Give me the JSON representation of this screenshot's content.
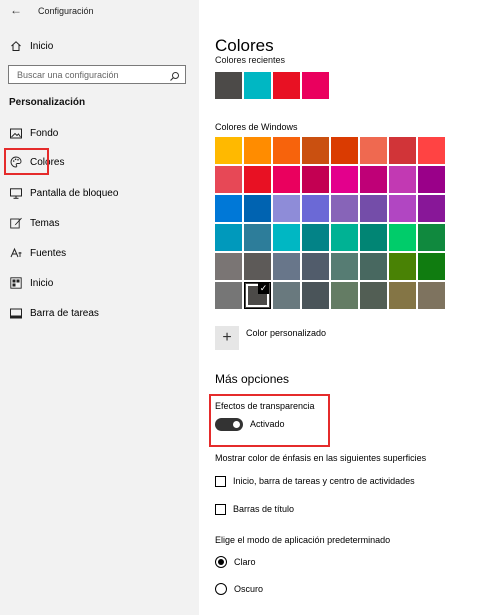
{
  "window": {
    "title": "Configuración"
  },
  "sidebar": {
    "home_label": "Inicio",
    "search_placeholder": "Buscar una configuración",
    "section_title": "Personalización",
    "items": [
      {
        "label": "Fondo",
        "icon": "image-icon"
      },
      {
        "label": "Colores",
        "icon": "palette-icon",
        "selected": true
      },
      {
        "label": "Pantalla de bloqueo",
        "icon": "monitor-icon"
      },
      {
        "label": "Temas",
        "icon": "brush-icon"
      },
      {
        "label": "Fuentes",
        "icon": "font-icon"
      },
      {
        "label": "Inicio",
        "icon": "start-icon"
      },
      {
        "label": "Barra de tareas",
        "icon": "taskbar-icon"
      }
    ]
  },
  "main": {
    "title": "Colores",
    "recent_label": "Colores recientes",
    "recent_colors": [
      "#4c4a48",
      "#00b7c3",
      "#e81123",
      "#ea005e"
    ],
    "windows_label": "Colores de Windows",
    "windows_colors": [
      [
        "#ffb900",
        "#ff8c00",
        "#f7630c",
        "#ca5010",
        "#da3b01",
        "#ef6950",
        "#d13438",
        "#ff4343"
      ],
      [
        "#e74856",
        "#e81123",
        "#ea005e",
        "#c30052",
        "#e3008c",
        "#bf0077",
        "#c239b3",
        "#9a0089"
      ],
      [
        "#0078d7",
        "#0063b1",
        "#8e8cd8",
        "#6b69d6",
        "#8764b8",
        "#744da9",
        "#b146c2",
        "#881798"
      ],
      [
        "#0099bc",
        "#2d7d9a",
        "#00b7c3",
        "#038387",
        "#00b294",
        "#018574",
        "#00cc6a",
        "#10893e"
      ],
      [
        "#7a7574",
        "#5d5a58",
        "#68768a",
        "#515c6b",
        "#567c73",
        "#486860",
        "#498205",
        "#107c10"
      ],
      [
        "#767676",
        "#4c4a48",
        "#69797e",
        "#4a5459",
        "#647c64",
        "#525e54",
        "#847545",
        "#7e735f"
      ]
    ],
    "selected_color": "#4c4a48",
    "custom_color_label": "Color personalizado",
    "more_options_title": "Más opciones",
    "transparency_label": "Efectos de transparencia",
    "transparency_value": "Activado",
    "accent_surfaces_label": "Mostrar color de énfasis en las siguientes superficies",
    "checkboxes": [
      {
        "label": "Inicio, barra de tareas y centro de actividades",
        "checked": false
      },
      {
        "label": "Barras de título",
        "checked": false
      }
    ],
    "app_mode_label": "Elige el modo de aplicación predeterminado",
    "radios": [
      {
        "label": "Claro",
        "checked": true
      },
      {
        "label": "Oscuro",
        "checked": false
      }
    ]
  },
  "colors": {
    "highlight": "#e52b2b",
    "sidebar_bg": "#f2f2f2"
  }
}
